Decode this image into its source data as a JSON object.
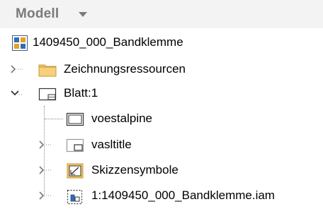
{
  "header": {
    "title": "Modell",
    "dropdown_icon": "chevron-down-icon"
  },
  "tree": {
    "root": {
      "label": "1409450_000_Bandklemme",
      "icon": "assembly-document-icon"
    },
    "items": [
      {
        "label": "Zeichnungsressourcen",
        "icon": "folder-icon",
        "expanded": false
      },
      {
        "label": "Blatt:1",
        "icon": "sheet-icon",
        "expanded": true,
        "children": [
          {
            "label": "voestalpine",
            "icon": "border-icon",
            "expandable": false
          },
          {
            "label": "vasltitle",
            "icon": "title-block-icon",
            "expandable": true
          },
          {
            "label": "Skizzensymbole",
            "icon": "sketch-symbols-icon",
            "expandable": true
          },
          {
            "label": "1:1409450_000_Bandklemme.iam",
            "icon": "drawing-view-icon",
            "expandable": true
          }
        ]
      }
    ]
  },
  "colors": {
    "header_bg": "#f3f3f3",
    "header_text": "#7a7a7a",
    "folder": "#f0c36a",
    "tree_line": "#8a8a8a"
  }
}
